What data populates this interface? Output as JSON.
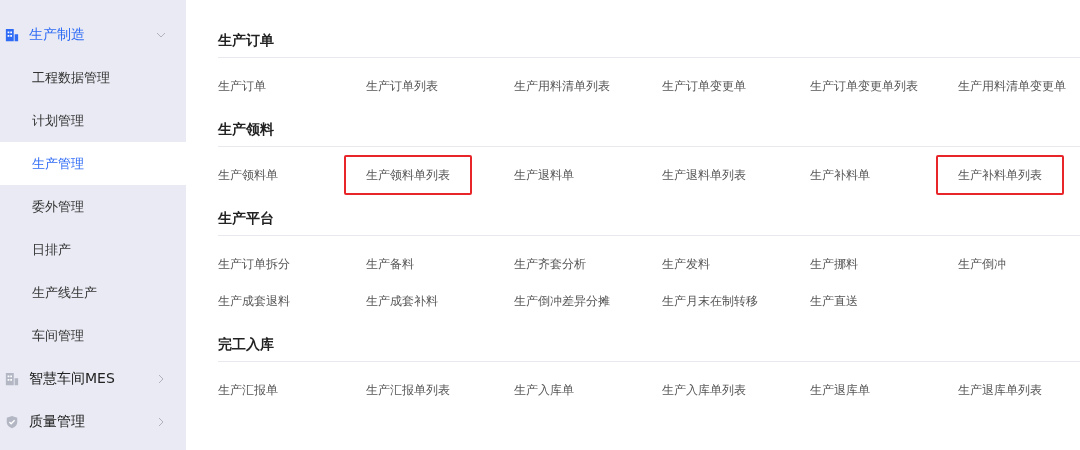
{
  "sidebar": {
    "items": [
      {
        "label": "生产制造",
        "kind": "building",
        "expanded": true,
        "children": [
          {
            "label": "工程数据管理",
            "selected": false
          },
          {
            "label": "计划管理",
            "selected": false
          },
          {
            "label": "生产管理",
            "selected": true
          },
          {
            "label": "委外管理",
            "selected": false
          },
          {
            "label": "日排产",
            "selected": false
          },
          {
            "label": "生产线生产",
            "selected": false
          },
          {
            "label": "车间管理",
            "selected": false
          }
        ]
      },
      {
        "label": "智慧车间MES",
        "kind": "building",
        "expanded": false
      },
      {
        "label": "质量管理",
        "kind": "shield",
        "expanded": false
      }
    ]
  },
  "sections": [
    {
      "title": "生产订单",
      "links": [
        {
          "label": "生产订单",
          "highlighted": false
        },
        {
          "label": "生产订单列表",
          "highlighted": false
        },
        {
          "label": "生产用料清单列表",
          "highlighted": false
        },
        {
          "label": "生产订单变更单",
          "highlighted": false
        },
        {
          "label": "生产订单变更单列表",
          "highlighted": false
        },
        {
          "label": "生产用料清单变更单",
          "highlighted": false
        }
      ]
    },
    {
      "title": "生产领料",
      "links": [
        {
          "label": "生产领料单",
          "highlighted": false
        },
        {
          "label": "生产领料单列表",
          "highlighted": true
        },
        {
          "label": "生产退料单",
          "highlighted": false
        },
        {
          "label": "生产退料单列表",
          "highlighted": false
        },
        {
          "label": "生产补料单",
          "highlighted": false
        },
        {
          "label": "生产补料单列表",
          "highlighted": true
        }
      ]
    },
    {
      "title": "生产平台",
      "links": [
        {
          "label": "生产订单拆分",
          "highlighted": false
        },
        {
          "label": "生产备料",
          "highlighted": false
        },
        {
          "label": "生产齐套分析",
          "highlighted": false
        },
        {
          "label": "生产发料",
          "highlighted": false
        },
        {
          "label": "生产挪料",
          "highlighted": false
        },
        {
          "label": "生产倒冲",
          "highlighted": false
        },
        {
          "label": "生产成套退料",
          "highlighted": false
        },
        {
          "label": "生产成套补料",
          "highlighted": false
        },
        {
          "label": "生产倒冲差异分摊",
          "highlighted": false
        },
        {
          "label": "生产月末在制转移",
          "highlighted": false
        },
        {
          "label": "生产直送",
          "highlighted": false
        }
      ]
    },
    {
      "title": "完工入库",
      "links": [
        {
          "label": "生产汇报单",
          "highlighted": false
        },
        {
          "label": "生产汇报单列表",
          "highlighted": false
        },
        {
          "label": "生产入库单",
          "highlighted": false
        },
        {
          "label": "生产入库单列表",
          "highlighted": false
        },
        {
          "label": "生产退库单",
          "highlighted": false
        },
        {
          "label": "生产退库单列表",
          "highlighted": false
        }
      ]
    }
  ]
}
